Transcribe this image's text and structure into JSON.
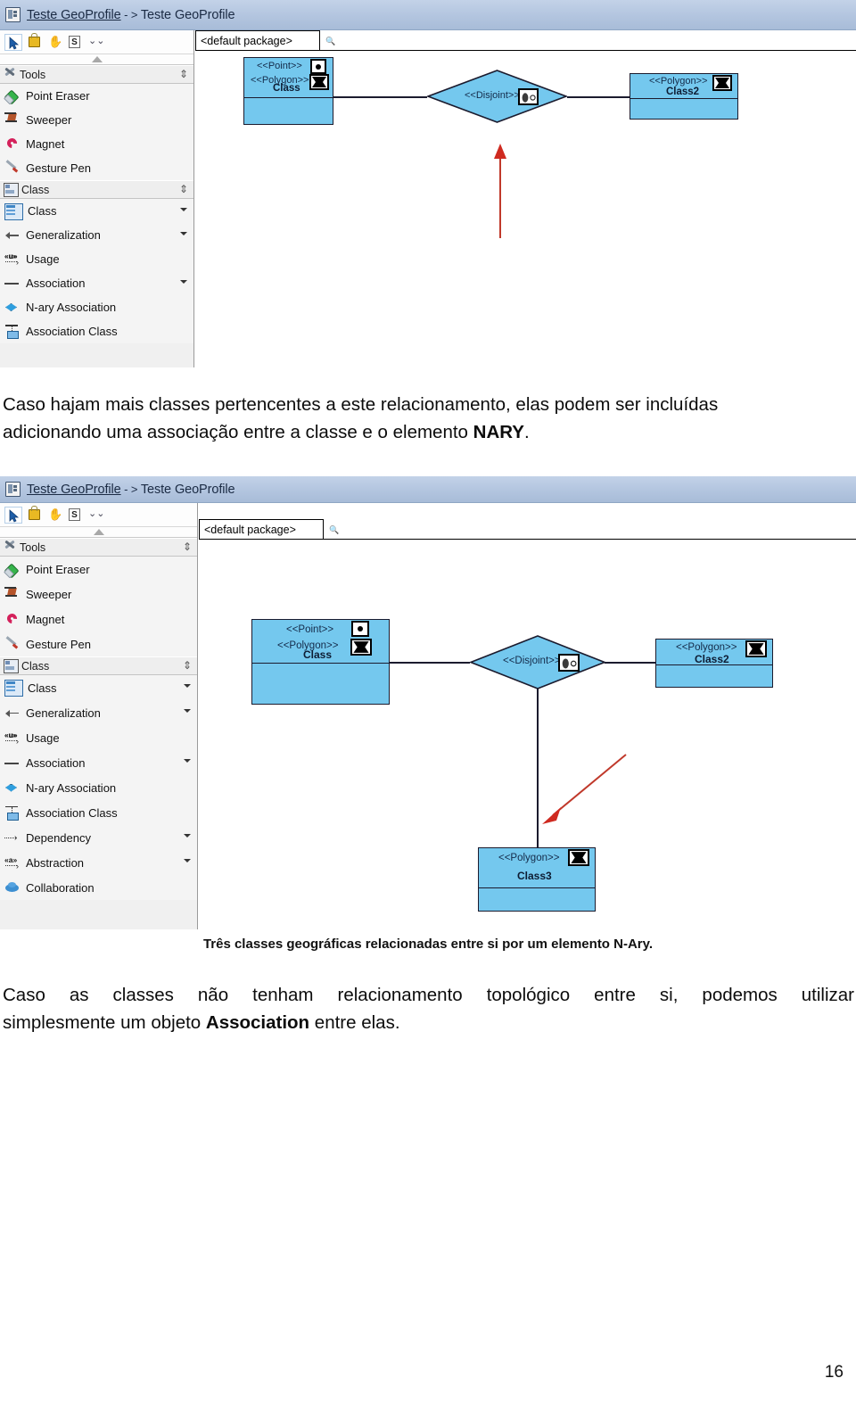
{
  "page": {
    "number": "16"
  },
  "screenshot1": {
    "titlebar": {
      "icon": "diagram-file-icon",
      "link_text": "Teste GeoProfile",
      "arrow": " - > ",
      "title": "Teste GeoProfile"
    },
    "toolbuttons": [
      {
        "name": "cursor-tool",
        "icon": "cursor-arrow-icon",
        "selected": true
      },
      {
        "name": "lock-tool",
        "icon": "lock-icon",
        "selected": false
      },
      {
        "name": "pan-tool",
        "icon": "hand-icon",
        "selected": false
      },
      {
        "name": "select-tool",
        "icon": "letter-s-icon",
        "label": "S",
        "selected": false
      },
      {
        "name": "more-tools",
        "icon": "double-chevron-down-icon",
        "selected": false
      }
    ],
    "groups": [
      {
        "label": "Tools",
        "icon": "tools-icon",
        "items": [
          {
            "label": "Point Eraser",
            "icon": "point-eraser-icon",
            "caret": false
          },
          {
            "label": "Sweeper",
            "icon": "sweeper-icon",
            "caret": false
          },
          {
            "label": "Magnet",
            "icon": "magnet-icon",
            "caret": false
          },
          {
            "label": "Gesture Pen",
            "icon": "gesture-pen-icon",
            "caret": false
          }
        ]
      },
      {
        "label": "Class",
        "icon": "class-group-icon",
        "items": [
          {
            "label": "Class",
            "icon": "class-icon",
            "caret": true
          },
          {
            "label": "Generalization",
            "icon": "generalization-icon",
            "caret": true
          },
          {
            "label": "Usage",
            "icon": "usage-icon",
            "caret": false
          },
          {
            "label": "Association",
            "icon": "association-icon",
            "caret": true
          },
          {
            "label": "N-ary Association",
            "icon": "n-ary-association-icon",
            "caret": false
          },
          {
            "label": "Association Class",
            "icon": "association-class-icon",
            "caret": false
          }
        ]
      }
    ],
    "canvas": {
      "package_tab": "<default package>",
      "magnifier_icon": "magnifier-icon",
      "class1": {
        "stereotype1": "<<Point>>",
        "stereotype2": "<<Polygon>>",
        "name": "Class"
      },
      "class2": {
        "stereotype1": "<<Polygon>>",
        "name": "Class2"
      },
      "nary": {
        "label": "<<Disjoint>>",
        "icon": "disjoint-geo-icon"
      },
      "annotation_arrow": "red-up-arrow"
    }
  },
  "paragraph1": {
    "line1": "Caso hajam mais classes pertencentes a este relacionamento, elas podem ser incluídas",
    "line2_a": "adicionando uma associação entre a classe e o elemento ",
    "line2_b": "NARY",
    "line2_c": "."
  },
  "screenshot2": {
    "titlebar": {
      "icon": "diagram-file-icon",
      "link_text": "Teste GeoProfile",
      "arrow": " - > ",
      "title": "Teste GeoProfile"
    },
    "toolbuttons": [
      {
        "name": "cursor-tool",
        "icon": "cursor-arrow-icon",
        "selected": true
      },
      {
        "name": "lock-tool",
        "icon": "lock-icon",
        "selected": false
      },
      {
        "name": "pan-tool",
        "icon": "hand-icon",
        "selected": false
      },
      {
        "name": "select-tool",
        "icon": "letter-s-icon",
        "label": "S",
        "selected": false
      },
      {
        "name": "more-tools",
        "icon": "double-chevron-down-icon",
        "selected": false
      }
    ],
    "groups": [
      {
        "label": "Tools",
        "icon": "tools-icon",
        "items": [
          {
            "label": "Point Eraser",
            "icon": "point-eraser-icon",
            "caret": false
          },
          {
            "label": "Sweeper",
            "icon": "sweeper-icon",
            "caret": false
          },
          {
            "label": "Magnet",
            "icon": "magnet-icon",
            "caret": false
          },
          {
            "label": "Gesture Pen",
            "icon": "gesture-pen-icon",
            "caret": false
          }
        ]
      },
      {
        "label": "Class",
        "icon": "class-group-icon",
        "items": [
          {
            "label": "Class",
            "icon": "class-icon",
            "caret": true
          },
          {
            "label": "Generalization",
            "icon": "generalization-icon",
            "caret": true
          },
          {
            "label": "Usage",
            "icon": "usage-icon",
            "caret": false
          },
          {
            "label": "Association",
            "icon": "association-icon",
            "caret": true
          },
          {
            "label": "N-ary Association",
            "icon": "n-ary-association-icon",
            "caret": false
          },
          {
            "label": "Association Class",
            "icon": "association-class-icon",
            "caret": false
          },
          {
            "label": "Dependency",
            "icon": "dependency-icon",
            "caret": true
          },
          {
            "label": "Abstraction",
            "icon": "abstraction-icon",
            "caret": true
          },
          {
            "label": "Collaboration",
            "icon": "collaboration-icon",
            "caret": false
          }
        ]
      }
    ],
    "canvas": {
      "package_tab": "<default package>",
      "magnifier_icon": "magnifier-icon",
      "class1": {
        "stereotype1": "<<Point>>",
        "stereotype2": "<<Polygon>>",
        "name": "Class"
      },
      "class2": {
        "stereotype1": "<<Polygon>>",
        "name": "Class2"
      },
      "class3": {
        "stereotype1": "<<Polygon>>",
        "name": "Class3"
      },
      "nary": {
        "label": "<<Disjoint>>",
        "icon": "disjoint-geo-icon"
      },
      "annotation_arrow": "red-diagonal-arrow"
    }
  },
  "caption2": "Três classes geográficas relacionadas entre si por um elemento N-Ary.",
  "paragraph2": {
    "line1": "Caso as classes não tenham relacionamento topológico entre si, podemos utilizar",
    "line2_a": "simplesmente um objeto ",
    "line2_b": "Association",
    "line2_c": " entre elas."
  }
}
